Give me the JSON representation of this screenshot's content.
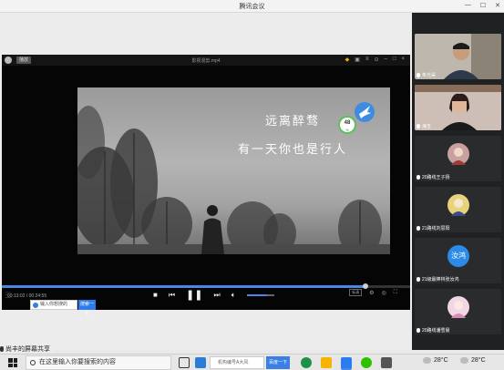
{
  "window": {
    "title": "腾讯会议",
    "minimize": "—",
    "maximize": "☐",
    "close": "✕"
  },
  "player": {
    "badge": "播放",
    "file_name": "影视混剪.mp4",
    "subtitle_line1": "远离醉骛",
    "subtitle_line2": "有一天你也是行人",
    "speed_value": "48",
    "speed_unit": "%",
    "time": "00:13:02 / 00:24:55",
    "progress_fraction": 0.89,
    "volume_fraction": 0.75,
    "rc_label": "标清",
    "icons": [
      "game-icon",
      "shirt-icon",
      "menu-icon",
      "minimize-icon",
      "pin-icon",
      "restore-icon",
      "close-icon"
    ]
  },
  "search": {
    "placeholder": "输入你想搜的",
    "button": "搜索一下"
  },
  "participants": [
    {
      "name": "朱光昊",
      "type": "video"
    },
    {
      "name": "海玉",
      "type": "video"
    },
    {
      "name": "20路线王子扬",
      "type": "avatar"
    },
    {
      "name": "21路线刘思阳",
      "type": "avatar"
    },
    {
      "name": "21级最棒林张汝鸿",
      "type": "avatar-text",
      "avatar_text": "汝鸿"
    },
    {
      "name": "20路线潘雪晨",
      "type": "avatar"
    }
  ],
  "share_indicator": "尚丰的屏幕共享",
  "taskbar": {
    "search_placeholder": "在这里输入你要搜索的内容",
    "browser_search_placeholder": "机构编号A大风",
    "browser_search_button": "百度一下",
    "weather1": "28°C",
    "weather2": "28°C"
  },
  "colors": {
    "accent": "#2f7bea",
    "panel_bg": "#202122",
    "progress": "#4a86e8"
  }
}
